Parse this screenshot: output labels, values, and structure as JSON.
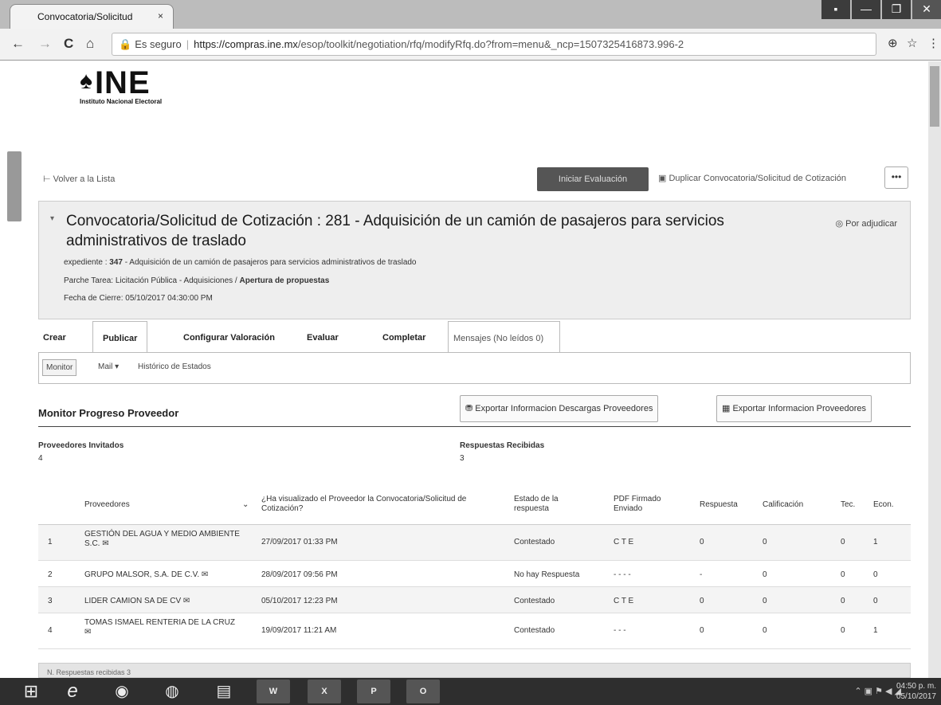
{
  "browser": {
    "tab_title": "Convocatoria/Solicitud",
    "tab_close": "×",
    "window_buttons": [
      "▪",
      "—",
      "❐",
      "✕"
    ],
    "nav": {
      "back": "←",
      "forward": "→",
      "reload": "C",
      "home": "⌂"
    },
    "lock": "🔒",
    "secure_label": "Es seguro",
    "url_host": "https://compras.ine.mx",
    "url_path": "/esop/toolkit/negotiation/rfq/modifyRfq.do?from=menu&_ncp=1507325416873.996-2",
    "zoom_icon": "⊕",
    "star_icon": "☆",
    "menu_icon": "⋮"
  },
  "logo": {
    "mark": "♠",
    "name": "INE",
    "subtitle": "Instituto Nacional Electoral"
  },
  "toolbar": {
    "back_icon": "⊢",
    "back_label": "Volver a la Lista",
    "start_eval": "Iniciar Evaluación",
    "duplicate_icon": "▣",
    "duplicate_label": "Duplicar Convocatoria/Solicitud de Cotización",
    "more": "•••"
  },
  "header": {
    "caret": "▾",
    "title": "Convocatoria/Solicitud de Cotización : 281 - Adquisición de un camión de pasajeros para servicios administrativos de traslado",
    "status_icon": "◎",
    "status": "Por adjudicar",
    "expediente_label": "expediente :",
    "expediente_num": "347",
    "expediente_desc": "- Adquisición de un camión de pasajeros para servicios administrativos de traslado",
    "task_prefix": "Parche Tarea: Licitación Pública - Adquisiciones /",
    "task_bold": "Apertura de propuestas",
    "close_date": "Fecha de Cierre: 05/10/2017 04:30:00 PM"
  },
  "tabs": {
    "crear": "Crear",
    "publicar": "Publicar",
    "configurar": "Configurar Valoración",
    "evaluar": "Evaluar",
    "completar": "Completar",
    "mensajes": "Mensajes (No leídos 0)"
  },
  "subnav": {
    "monitor": "Monitor",
    "mail": "Mail ▾",
    "historico": "Histórico de Estados"
  },
  "monitor": {
    "title": "Monitor Progreso Proveedor",
    "export_downloads_icon": "⛃",
    "export_downloads": "Exportar Informacion Descargas Proveedores",
    "export_suppliers_icon": "▦",
    "export_suppliers": "Exportar Informacion Proveedores",
    "invited_label": "Proveedores Invitados",
    "invited_value": "4",
    "responses_label": "Respuestas Recibidas",
    "responses_value": "3"
  },
  "table": {
    "headers": {
      "proveedores": "Proveedores",
      "sort": "⌄",
      "visualizado": "¿Ha visualizado el Proveedor la Convocatoria/Solicitud de Cotización?",
      "estado": "Estado de la respuesta",
      "pdf": "PDF Firmado Enviado",
      "respuesta": "Respuesta",
      "calificacion": "Calificación",
      "tec": "Tec.",
      "econ": "Econ."
    },
    "rows": [
      {
        "num": "1",
        "name": "GESTIÓN DEL AGUA Y MEDIO AMBIENTE S.C.",
        "date": "27/09/2017 01:33 PM",
        "estado": "Contestado",
        "pdf": "C T E",
        "respuesta": "0",
        "calificacion": "0",
        "tec": "0",
        "econ": "1"
      },
      {
        "num": "2",
        "name": "GRUPO MALSOR, S.A. DE C.V.",
        "date": "28/09/2017 09:56 PM",
        "estado": "No hay Respuesta",
        "pdf": "- - - -",
        "respuesta": "-",
        "calificacion": "0",
        "tec": "0",
        "econ": "0"
      },
      {
        "num": "3",
        "name": "LIDER CAMION SA DE CV",
        "date": "05/10/2017 12:23 PM",
        "estado": "Contestado",
        "pdf": "C T E",
        "respuesta": "0",
        "calificacion": "0",
        "tec": "0",
        "econ": "0"
      },
      {
        "num": "4",
        "name": "TOMAS ISMAEL RENTERIA DE LA CRUZ",
        "date": "19/09/2017 11:21 AM",
        "estado": "Contestado",
        "pdf": "- - -",
        "respuesta": "0",
        "calificacion": "0",
        "tec": "0",
        "econ": "1"
      }
    ],
    "contact_icon": "✉"
  },
  "footer_text": "N. Respuestas recibidas 3",
  "taskbar": {
    "start": "⊞",
    "apps": [
      "e",
      "◉",
      "◍",
      "▤",
      "W",
      "X",
      "P",
      "O"
    ],
    "tray": "⌃ ▣ ⚑ ◀ ◢",
    "time": "04:50 p. m.",
    "date": "05/10/2017"
  }
}
